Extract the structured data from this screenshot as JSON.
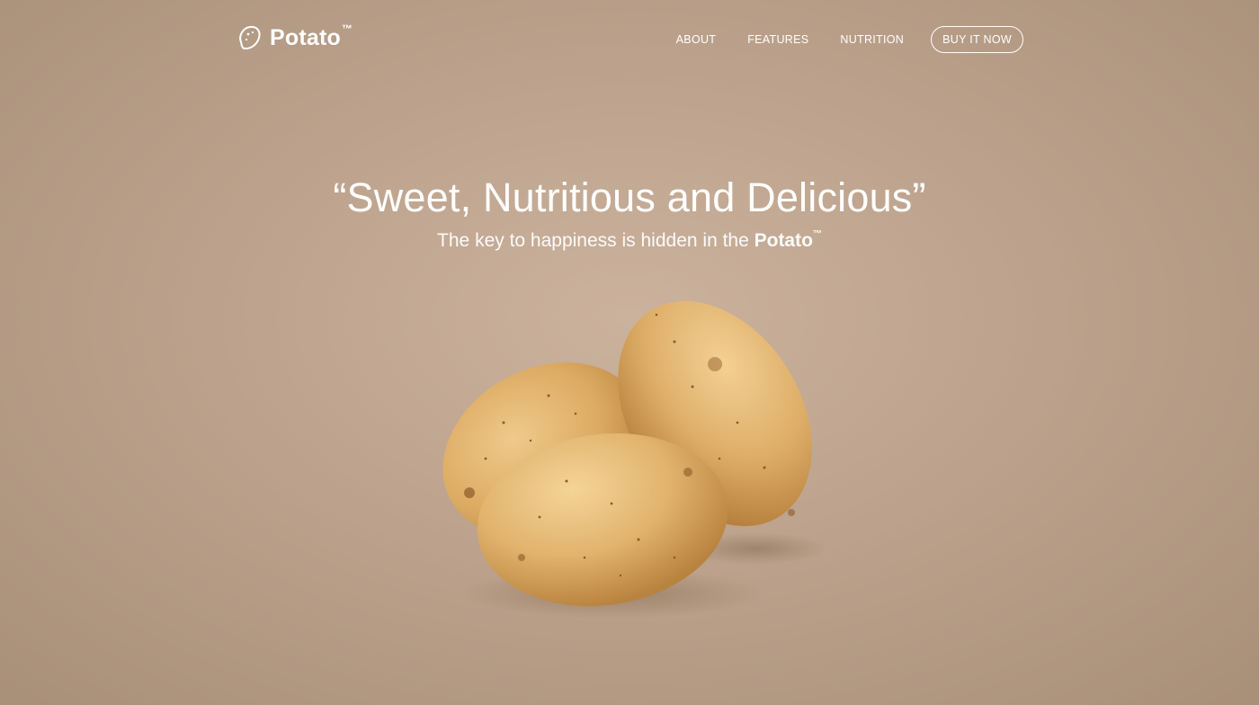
{
  "brand": {
    "name": "Potato",
    "trademark": "™"
  },
  "nav": {
    "links": [
      "ABOUT",
      "FEATURES",
      "NUTRITION"
    ],
    "cta": "BUY IT NOW"
  },
  "hero": {
    "headline": "“Sweet, Nutritious and Delicious”",
    "subline_prefix": "The key to happiness is hidden in the ",
    "subline_brand": "Potato",
    "subline_tm": "™"
  },
  "colors": {
    "background": "#bda38d",
    "text": "#ffffff",
    "potato": "#e0b066"
  }
}
